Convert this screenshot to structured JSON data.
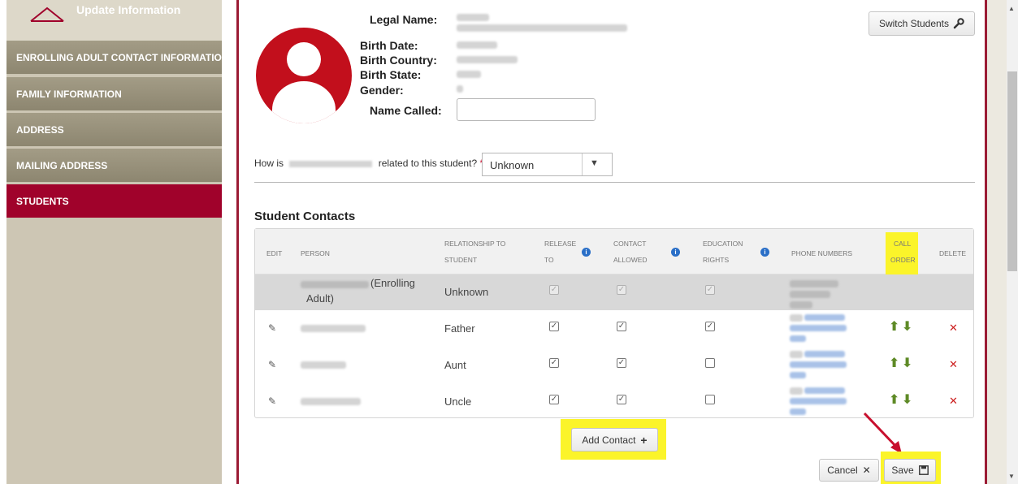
{
  "sidebar": {
    "title": "Update Information",
    "items": [
      {
        "label": "ENROLLING ADULT CONTACT INFORMATION"
      },
      {
        "label": "FAMILY INFORMATION"
      },
      {
        "label": "ADDRESS"
      },
      {
        "label": "MAILING ADDRESS"
      },
      {
        "label": "STUDENTS",
        "active": true
      }
    ]
  },
  "student": {
    "labels": {
      "legal_name": "Legal Name:",
      "birth_date": "Birth Date:",
      "birth_country": "Birth Country:",
      "birth_state": "Birth State:",
      "gender": "Gender:",
      "name_called": "Name Called:"
    },
    "name_called_value": ""
  },
  "switch_button": {
    "label": "Switch Students",
    "icon": "wrench-icon"
  },
  "relation": {
    "prefix": "How is",
    "suffix": "related to this student?",
    "required_mark": "*",
    "selected": "Unknown"
  },
  "contacts": {
    "title": "Student Contacts",
    "headers": {
      "edit": "EDIT",
      "person": "PERSON",
      "relationship_1": "RELATIONSHIP TO",
      "relationship_2": "STUDENT",
      "release_1": "RELEASE",
      "release_2": "TO",
      "contact_1": "CONTACT",
      "contact_2": "ALLOWED",
      "education_1": "EDUCATION",
      "education_2": "RIGHTS",
      "phone": "PHONE NUMBERS",
      "call_1": "CALL",
      "call_2": "ORDER",
      "delete": "DELETE"
    },
    "enrolling_row": {
      "person_suffix": "(Enrolling",
      "person_suffix2": "Adult)",
      "relationship": "Unknown"
    },
    "rows": [
      {
        "relationship": "Father",
        "release": true,
        "contact": true,
        "education": true
      },
      {
        "relationship": "Aunt",
        "release": true,
        "contact": true,
        "education": false
      },
      {
        "relationship": "Uncle",
        "release": true,
        "contact": true,
        "education": false
      }
    ]
  },
  "actions": {
    "add_contact": "Add Contact",
    "cancel": "Cancel",
    "save": "Save"
  },
  "colors": {
    "brand": "#a0022b",
    "highlight": "#fbf42a",
    "sidebar": "#a39c86"
  }
}
